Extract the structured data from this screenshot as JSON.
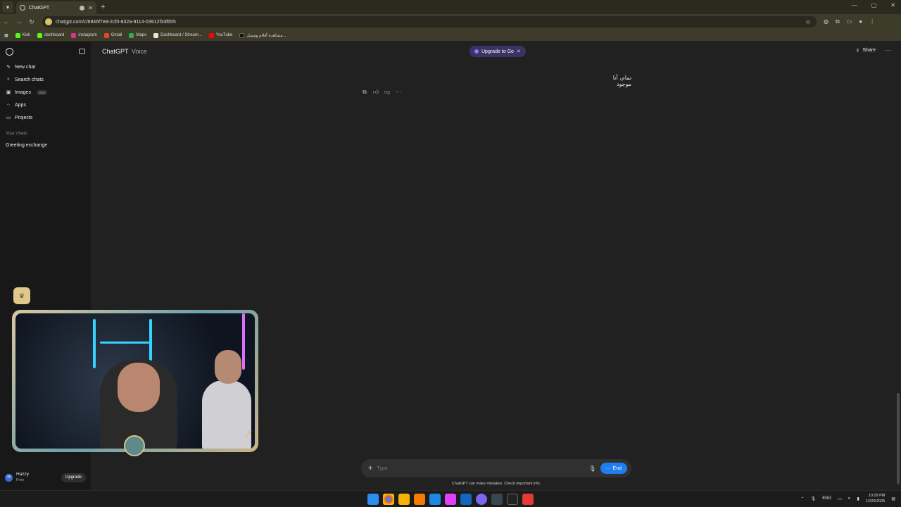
{
  "browser": {
    "tab_title": "ChatGPT",
    "url": "chatgpt.com/c/6946f7e8-2cf0-832a-9114-03912f33f655",
    "bookmarks": [
      "Kick",
      "dashboard",
      "instagram",
      "Gmail",
      "Maps",
      "Dashboard / Stream...",
      "YouTube",
      "مشاهدة أفلام ومسل..."
    ]
  },
  "sidebar": {
    "items": [
      {
        "icon": "✎",
        "label": "New chat"
      },
      {
        "icon": "⌕",
        "label": "Search chats"
      },
      {
        "icon": "▣",
        "label": "Images",
        "badge": "NEW"
      },
      {
        "icon": "⁘",
        "label": "Apps"
      },
      {
        "icon": "▭",
        "label": "Projects"
      }
    ],
    "section_label": "Your chats",
    "chats": [
      "Greeting exchange"
    ],
    "user": {
      "initial": "H",
      "name": "Hazzy",
      "plan": "Free",
      "upgrade_label": "Upgrade"
    }
  },
  "header": {
    "brand": "ChatGPT",
    "brand_sub": "Voice",
    "upgrade_pill": "Upgrade to Go",
    "share_label": "Share"
  },
  "conversation": {
    "message": "تمام، أنا موجود"
  },
  "composer": {
    "placeholder": "Type",
    "end_label": "End",
    "disclaimer": "ChatGPT can make mistakes. Check important info."
  },
  "taskbar": {
    "lang": "ENG",
    "time": "10:29 PM",
    "date": "12/20/2025"
  },
  "colors": {
    "accent_blue": "#1f7ef0",
    "upgrade_pill": "#3b3366",
    "kick_green": "#53fc18"
  }
}
